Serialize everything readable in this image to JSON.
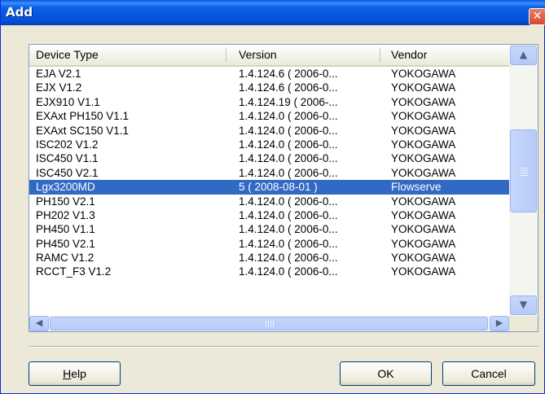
{
  "window": {
    "title": "Add",
    "close_glyph": "✕"
  },
  "list": {
    "columns": [
      "Device Type",
      "Version",
      "Vendor"
    ],
    "rows": [
      [
        "EJA V2.1",
        "1.4.124.6 ( 2006-0...",
        "YOKOGAWA"
      ],
      [
        "EJX V1.2",
        "1.4.124.6 ( 2006-0...",
        "YOKOGAWA"
      ],
      [
        "EJX910 V1.1",
        "1.4.124.19 ( 2006-...",
        "YOKOGAWA"
      ],
      [
        "EXAxt PH150 V1.1",
        "1.4.124.0 ( 2006-0...",
        "YOKOGAWA"
      ],
      [
        "EXAxt SC150 V1.1",
        "1.4.124.0 ( 2006-0...",
        "YOKOGAWA"
      ],
      [
        "ISC202 V1.2",
        "1.4.124.0 ( 2006-0...",
        "YOKOGAWA"
      ],
      [
        "ISC450 V1.1",
        "1.4.124.0 ( 2006-0...",
        "YOKOGAWA"
      ],
      [
        "ISC450 V2.1",
        "1.4.124.0 ( 2006-0...",
        "YOKOGAWA"
      ],
      [
        "Lgx3200MD",
        "5 ( 2008-08-01 )",
        "Flowserve"
      ],
      [
        "PH150 V2.1",
        "1.4.124.0 ( 2006-0...",
        "YOKOGAWA"
      ],
      [
        "PH202 V1.3",
        "1.4.124.0 ( 2006-0...",
        "YOKOGAWA"
      ],
      [
        "PH450 V1.1",
        "1.4.124.0 ( 2006-0...",
        "YOKOGAWA"
      ],
      [
        "PH450 V2.1",
        "1.4.124.0 ( 2006-0...",
        "YOKOGAWA"
      ],
      [
        "RAMC V1.2",
        "1.4.124.0 ( 2006-0...",
        "YOKOGAWA"
      ],
      [
        "RCCT_F3 V1.2",
        "1.4.124.0 ( 2006-0...",
        "YOKOGAWA"
      ]
    ],
    "selected_index": 8,
    "scroll": {
      "up": "▲",
      "down": "▼",
      "left": "◀",
      "right": "▶"
    }
  },
  "buttons": {
    "help_mnemonic": "H",
    "help_rest": "elp",
    "ok": "OK",
    "cancel": "Cancel"
  },
  "colors": {
    "selection": "#316ac5",
    "titlebar": "#0a5fe8"
  }
}
